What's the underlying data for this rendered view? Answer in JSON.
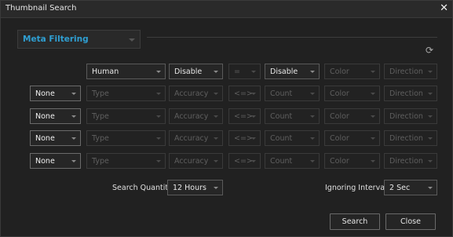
{
  "window": {
    "title": "Thumbnail Search"
  },
  "meta": {
    "label": "Meta Filtering"
  },
  "row0": {
    "type": "Human",
    "accuracy": "Disable",
    "op": "=",
    "count": "Disable",
    "color": "Color",
    "direction": "Direction"
  },
  "rows": [
    {
      "logic": "None",
      "type": "Type",
      "accuracy": "Accuracy",
      "op": "<=>",
      "count": "Count",
      "color": "Color",
      "direction": "Direction"
    },
    {
      "logic": "None",
      "type": "Type",
      "accuracy": "Accuracy",
      "op": "<=>",
      "count": "Count",
      "color": "Color",
      "direction": "Direction"
    },
    {
      "logic": "None",
      "type": "Type",
      "accuracy": "Accuracy",
      "op": "<=>",
      "count": "Count",
      "color": "Color",
      "direction": "Direction"
    },
    {
      "logic": "None",
      "type": "Type",
      "accuracy": "Accuracy",
      "op": "<=>",
      "count": "Count",
      "color": "Color",
      "direction": "Direction"
    }
  ],
  "search_quantity": {
    "label": "Search Quantity",
    "value": "12 Hours"
  },
  "ignoring_interval": {
    "label": "Ignoring Interval",
    "value": "2 Sec"
  },
  "buttons": {
    "search": "Search",
    "close": "Close"
  }
}
